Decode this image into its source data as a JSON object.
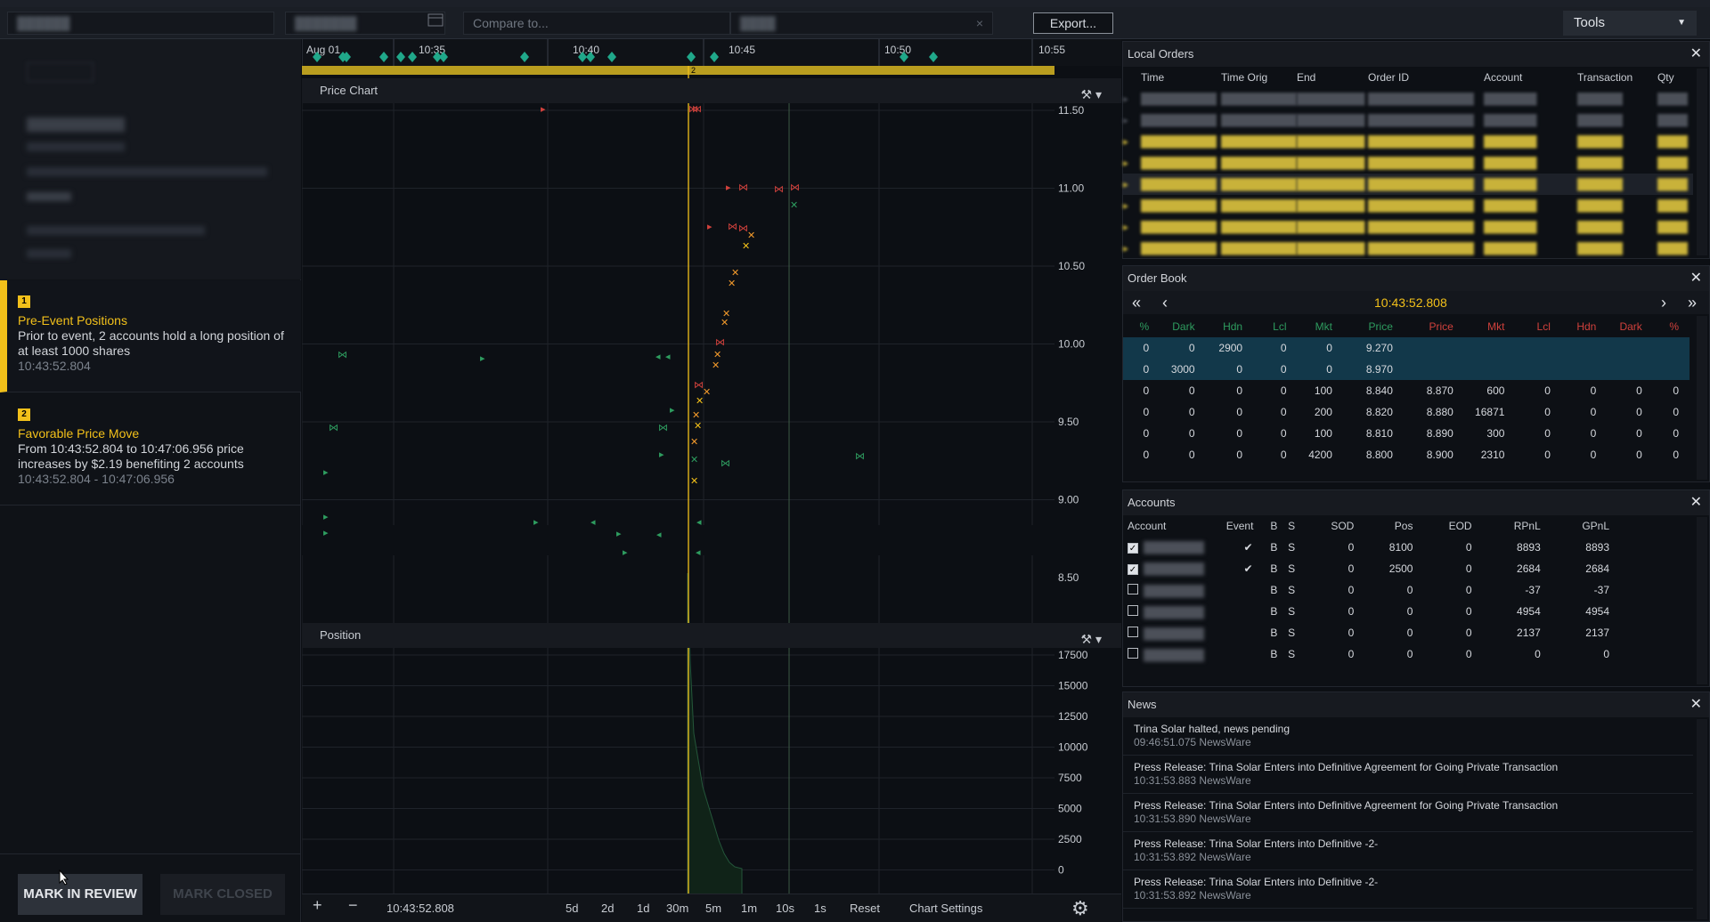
{
  "topbar": {
    "compare_placeholder": "Compare to...",
    "export_label": "Export...",
    "tools_label": "Tools"
  },
  "events": [
    {
      "num": "1",
      "title": "Pre-Event Positions",
      "desc": "Prior to event, 2 accounts hold a long position of at least 1000 shares",
      "time": "10:43:52.804"
    },
    {
      "num": "2",
      "title": "Favorable Price Move",
      "desc": "From 10:43:52.804 to 10:47:06.956 price increases by $2.19 benefiting 2 accounts",
      "time": "10:43:52.804 - 10:47:06.956"
    }
  ],
  "actions": {
    "review": "MARK IN REVIEW",
    "closed": "MARK CLOSED"
  },
  "timeline": {
    "ticks": [
      "Aug 01",
      "10:35",
      "10:40",
      "10:45",
      "10:50",
      "10:55"
    ],
    "marker": "2"
  },
  "price_chart": {
    "title": "Price Chart",
    "y_ticks": [
      "11.50",
      "11.00",
      "10.50",
      "10.00",
      "9.50",
      "9.00",
      "8.50"
    ]
  },
  "position_chart": {
    "title": "Position",
    "y_ticks": [
      "17500",
      "15000",
      "12500",
      "10000",
      "7500",
      "5000",
      "2500",
      "0"
    ]
  },
  "bottom": {
    "plus": "+",
    "minus": "−",
    "time": "10:43:52.808",
    "ranges": [
      "5d",
      "2d",
      "1d",
      "30m",
      "5m",
      "1m",
      "10s",
      "1s"
    ],
    "reset": "Reset",
    "settings": "Chart Settings"
  },
  "local_orders": {
    "title": "Local Orders",
    "columns": [
      "Time",
      "Time Orig",
      "End",
      "Order ID",
      "Account",
      "Transaction",
      "Qty"
    ]
  },
  "order_book": {
    "title": "Order Book",
    "time": "10:43:52.808",
    "columns": [
      "%",
      "Dark",
      "Hdn",
      "Lcl",
      "Mkt",
      "Price",
      "Price",
      "Mkt",
      "Lcl",
      "Hdn",
      "Dark",
      "%"
    ],
    "rows": [
      [
        "0",
        "0",
        "2900",
        "0",
        "0",
        "9.270",
        "",
        "",
        "",
        "",
        "",
        ""
      ],
      [
        "0",
        "3000",
        "0",
        "0",
        "0",
        "8.970",
        "",
        "",
        "",
        "",
        "",
        ""
      ],
      [
        "0",
        "0",
        "0",
        "0",
        "100",
        "8.840",
        "8.870",
        "600",
        "0",
        "0",
        "0",
        "0"
      ],
      [
        "0",
        "0",
        "0",
        "0",
        "200",
        "8.820",
        "8.880",
        "16871",
        "0",
        "0",
        "0",
        "0"
      ],
      [
        "0",
        "0",
        "0",
        "0",
        "100",
        "8.810",
        "8.890",
        "300",
        "0",
        "0",
        "0",
        "0"
      ],
      [
        "0",
        "0",
        "0",
        "0",
        "4200",
        "8.800",
        "8.900",
        "2310",
        "0",
        "0",
        "0",
        "0"
      ]
    ]
  },
  "accounts": {
    "title": "Accounts",
    "columns": [
      "Account",
      "Event",
      "B",
      "S",
      "SOD",
      "Pos",
      "EOD",
      "RPnL",
      "GPnL"
    ],
    "rows": [
      {
        "checked": true,
        "event": "✔",
        "sod": "0",
        "pos": "8100",
        "eod": "0",
        "rpnl": "8893",
        "gpnl": "8893"
      },
      {
        "checked": true,
        "event": "✔",
        "sod": "0",
        "pos": "2500",
        "eod": "0",
        "rpnl": "2684",
        "gpnl": "2684"
      },
      {
        "checked": false,
        "event": "",
        "sod": "0",
        "pos": "0",
        "eod": "0",
        "rpnl": "-37",
        "gpnl": "-37"
      },
      {
        "checked": false,
        "event": "",
        "sod": "0",
        "pos": "0",
        "eod": "0",
        "rpnl": "4954",
        "gpnl": "4954"
      },
      {
        "checked": false,
        "event": "",
        "sod": "0",
        "pos": "0",
        "eod": "0",
        "rpnl": "2137",
        "gpnl": "2137"
      },
      {
        "checked": false,
        "event": "",
        "sod": "0",
        "pos": "0",
        "eod": "0",
        "rpnl": "0",
        "gpnl": "0"
      }
    ],
    "b_label": "B",
    "s_label": "S"
  },
  "news": {
    "title": "News",
    "items": [
      {
        "headline": "Trina Solar halted, news pending",
        "time": "09:46:51.075  NewsWare"
      },
      {
        "headline": "Press Release: Trina Solar Enters into Definitive Agreement for Going Private Transaction",
        "time": "10:31:53.883  NewsWare"
      },
      {
        "headline": "Press Release: Trina Solar Enters into Definitive Agreement for Going Private Transaction",
        "time": "10:31:53.890  NewsWare"
      },
      {
        "headline": "Press Release: Trina Solar Enters into Definitive -2-",
        "time": "10:31:53.892  NewsWare"
      },
      {
        "headline": "Press Release: Trina Solar Enters into Definitive -2-",
        "time": "10:31:53.892  NewsWare"
      }
    ]
  },
  "colors": {
    "accent": "#f2c01a",
    "buy": "#2e9c5f",
    "sell": "#d0413c",
    "selected": "#12384a"
  }
}
